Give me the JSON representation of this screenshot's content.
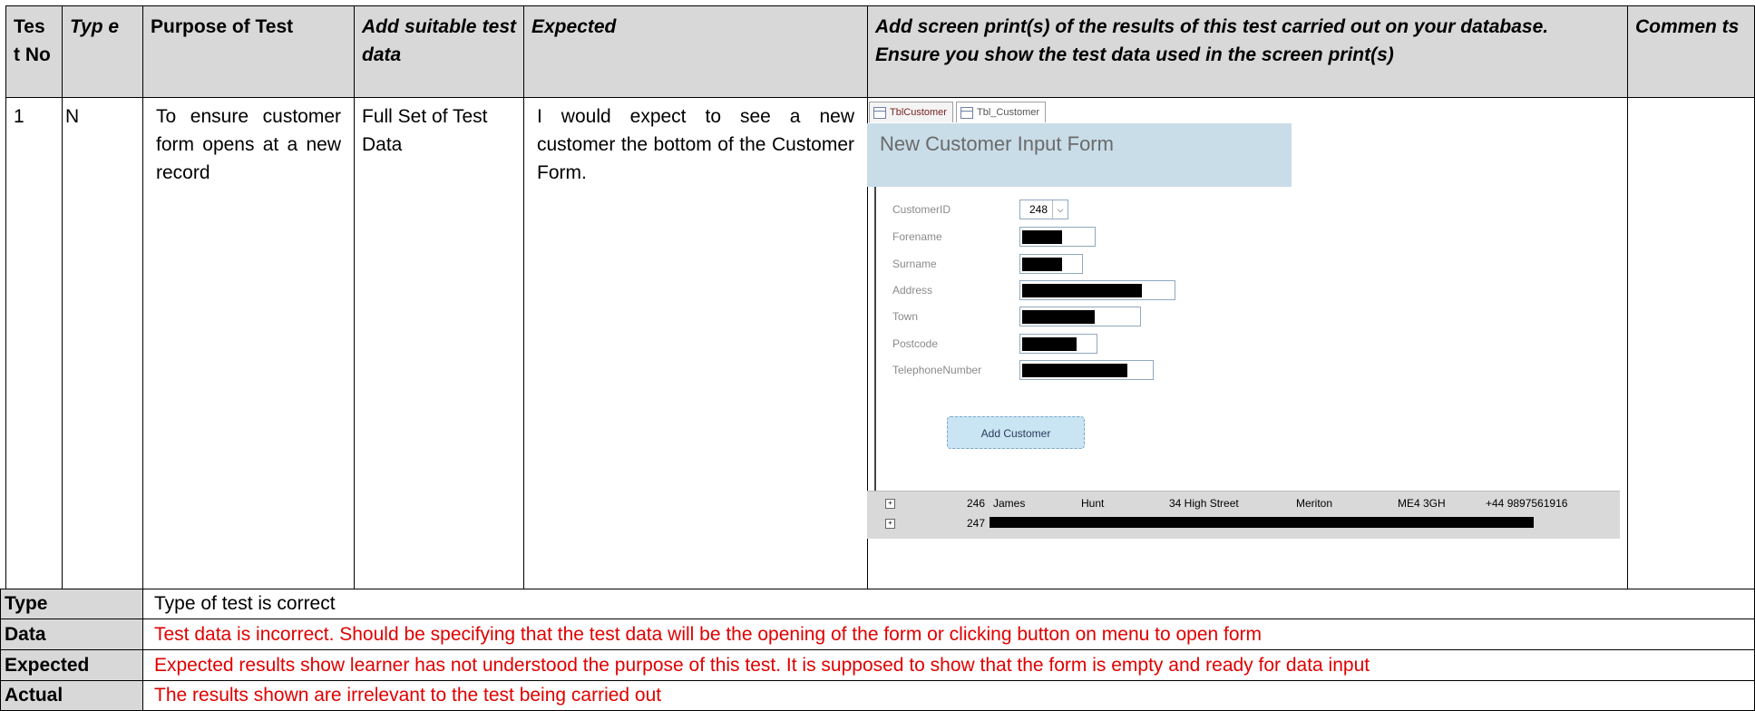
{
  "header": {
    "test_no": "Tes t No",
    "type": "Typ e",
    "purpose": "Purpose of Test",
    "test_data": "Add suitable test data",
    "expected": "Expected",
    "screen_print": "Add screen print(s) of the results of this test carried out on your database. Ensure you show the test data used in the screen print(s)",
    "comments": "Commen ts"
  },
  "row1": {
    "no": "1",
    "type": "N",
    "purpose": "To ensure customer form opens at a new record",
    "test_data": "Full Set of Test Data",
    "expected": "I would expect to see a new customer the bottom of the Customer Form.",
    "comments": ""
  },
  "screenshot": {
    "tab1": "TblCustomer",
    "tab2": "Tbl_Customer",
    "form_title": "New Customer Input Form",
    "fields": [
      {
        "label": "CustomerID",
        "value": "248"
      },
      {
        "label": "Forename",
        "value": ""
      },
      {
        "label": "Surname",
        "value": ""
      },
      {
        "label": "Address",
        "value": ""
      },
      {
        "label": "Town",
        "value": ""
      },
      {
        "label": "Postcode",
        "value": ""
      },
      {
        "label": "TelephoneNumber",
        "value": ""
      }
    ],
    "button": "Add Customer",
    "records": [
      {
        "id": "246",
        "forename": "James",
        "surname": "Hunt",
        "address": "34 High Street",
        "town": "Meriton",
        "postcode": "ME4 3GH",
        "phone": "+44 9897561916"
      },
      {
        "id": "247"
      }
    ]
  },
  "feedback": [
    {
      "label": "Type",
      "text": "Type of test is correct",
      "color": "#000000"
    },
    {
      "label": "Data",
      "text": "Test data is incorrect. Should be specifying that the test data will be the opening of the form or clicking button on menu to open form",
      "color": "#e00000"
    },
    {
      "label": "Expected",
      "text": "Expected results show learner has not understood the purpose of this test.  It is supposed to show that the form is empty and ready for data input",
      "color": "#e00000"
    },
    {
      "label": "Actual",
      "text": "The results shown are irrelevant to the test being carried out",
      "color": "#e00000"
    }
  ]
}
